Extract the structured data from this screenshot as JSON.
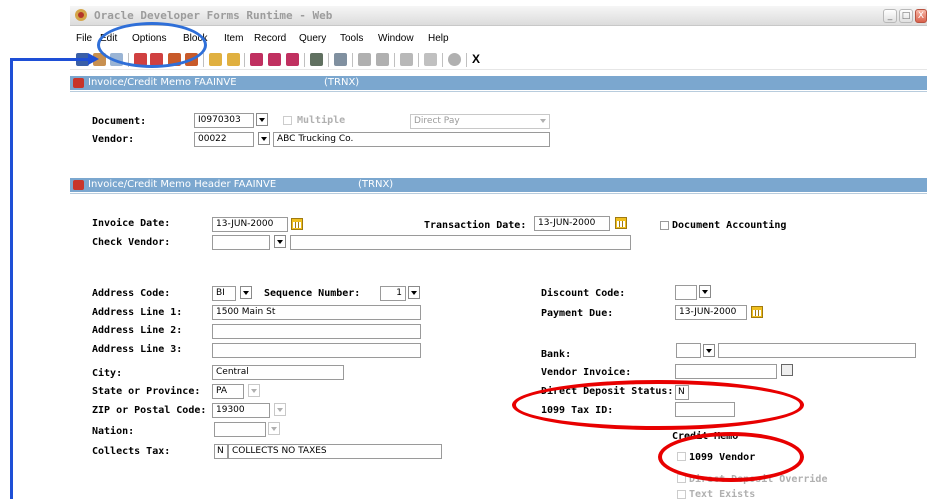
{
  "window": {
    "title": "Oracle Developer Forms Runtime - Web",
    "min": "_",
    "max": "□",
    "close": "X"
  },
  "menu": [
    "File",
    "Edit",
    "Options",
    "Block",
    "Item",
    "Record",
    "Query",
    "Tools",
    "Window",
    "Help"
  ],
  "toolbar": {
    "close_label": "X"
  },
  "key_block": {
    "title": "Invoice/Credit Memo  FAAINVE",
    "tag": "(TRNX)",
    "document_label": "Document:",
    "document_value": "I0970303",
    "multiple_label": "Multiple",
    "pay_type": "Direct Pay",
    "vendor_label": "Vendor:",
    "vendor_id": "00022",
    "vendor_name": "ABC Trucking Co."
  },
  "header_block": {
    "title": "Invoice/Credit Memo Header  FAAINVE",
    "tag": "(TRNX)",
    "invoice_date_label": "Invoice Date:",
    "invoice_date": "13-JUN-2000",
    "transaction_date_label": "Transaction Date:",
    "transaction_date": "13-JUN-2000",
    "document_accounting_label": "Document Accounting",
    "check_vendor_label": "Check Vendor:",
    "address_code_label": "Address Code:",
    "address_code": "BI",
    "sequence_number_label": "Sequence Number:",
    "sequence_number": "1",
    "address1_label": "Address Line 1:",
    "address1": "1500 Main St",
    "address2_label": "Address Line 2:",
    "address3_label": "Address Line 3:",
    "city_label": "City:",
    "city": "Central",
    "state_label": "State or Province:",
    "state": "PA",
    "zip_label": "ZIP or Postal Code:",
    "zip": "19300",
    "nation_label": "Nation:",
    "collects_tax_label": "Collects Tax:",
    "collects_tax_code": "N",
    "collects_tax_desc": "COLLECTS NO TAXES",
    "discount_code_label": "Discount Code:",
    "payment_due_label": "Payment Due:",
    "payment_due": "13-JUN-2000",
    "bank_label": "Bank:",
    "vendor_invoice_label": "Vendor Invoice:",
    "direct_deposit_label": "Direct Deposit Status:",
    "direct_deposit_value": "N",
    "tax_id_label": "1099 Tax ID:",
    "credit_memo_label": "Credit Memo",
    "vendor_1099_label": "1099 Vendor",
    "dd_override_label": "Direct Deposit Override",
    "text_exists_label": "Text Exists"
  },
  "colors": {
    "frame_bar": "#7ba7cf",
    "highlight": "#e80000",
    "annotation": "#1e4fd6"
  }
}
